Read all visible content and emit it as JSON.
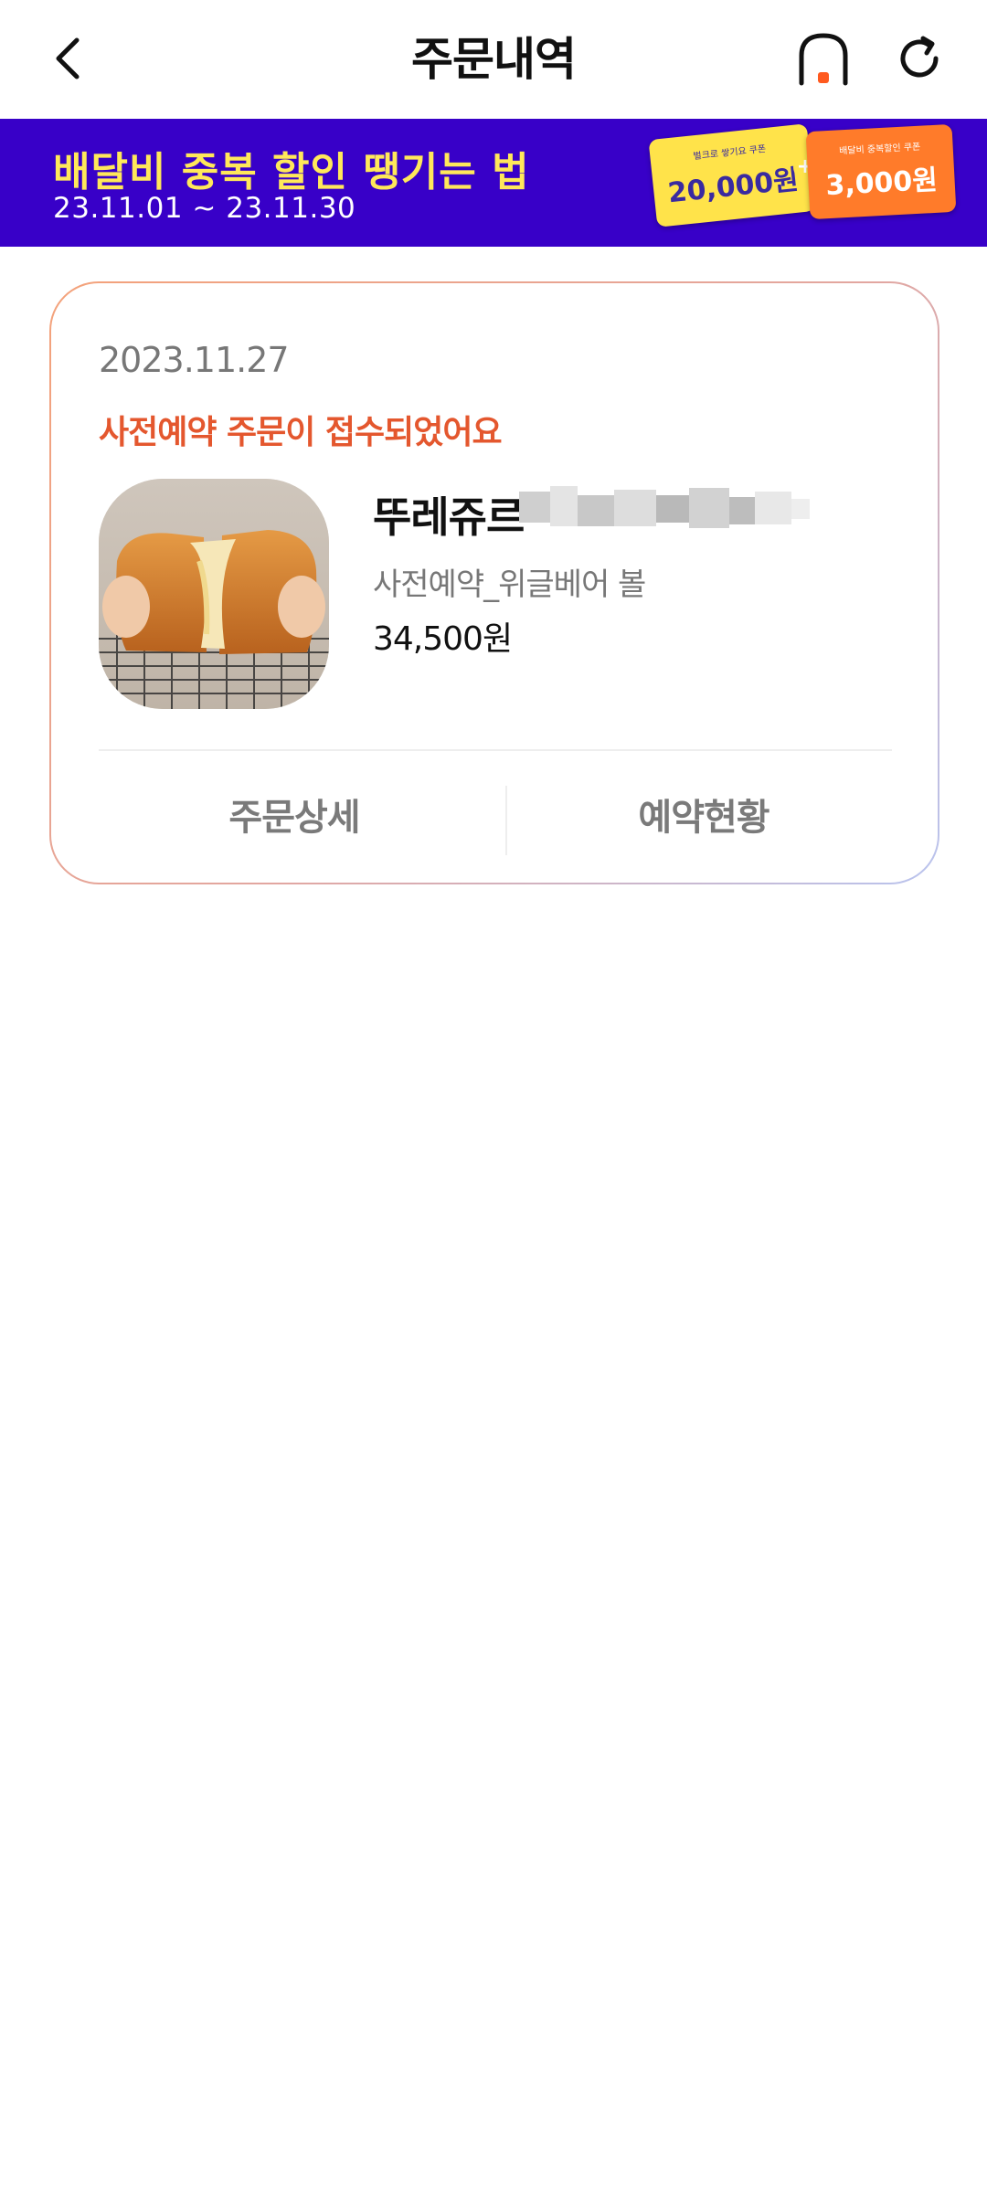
{
  "header": {
    "title": "주문내역",
    "back_icon": "chevron-left-icon",
    "home_icon": "home-icon",
    "refresh_icon": "refresh-icon"
  },
  "banner": {
    "title": "배달비 중복 할인 땡기는 법",
    "date_range": "23.11.01 ~ 23.11.30",
    "coupons": [
      {
        "caption": "벌크로 쌓기요 쿠폰",
        "amount": "20,000원"
      },
      {
        "caption": "배달비 중복할인 쿠폰",
        "amount": "3,000원"
      }
    ],
    "bg_color": "#3800c8",
    "title_color": "#ffe85a"
  },
  "order": {
    "date": "2023.11.27",
    "status": "사전예약 주문이 접수되었어요",
    "status_color": "#e4572e",
    "store_name": "뚜레쥬르",
    "menu_name": "사전예약_위글베어 볼",
    "price": "34,500원",
    "detail_button": "주문상세",
    "reservation_button": "예약현황"
  }
}
